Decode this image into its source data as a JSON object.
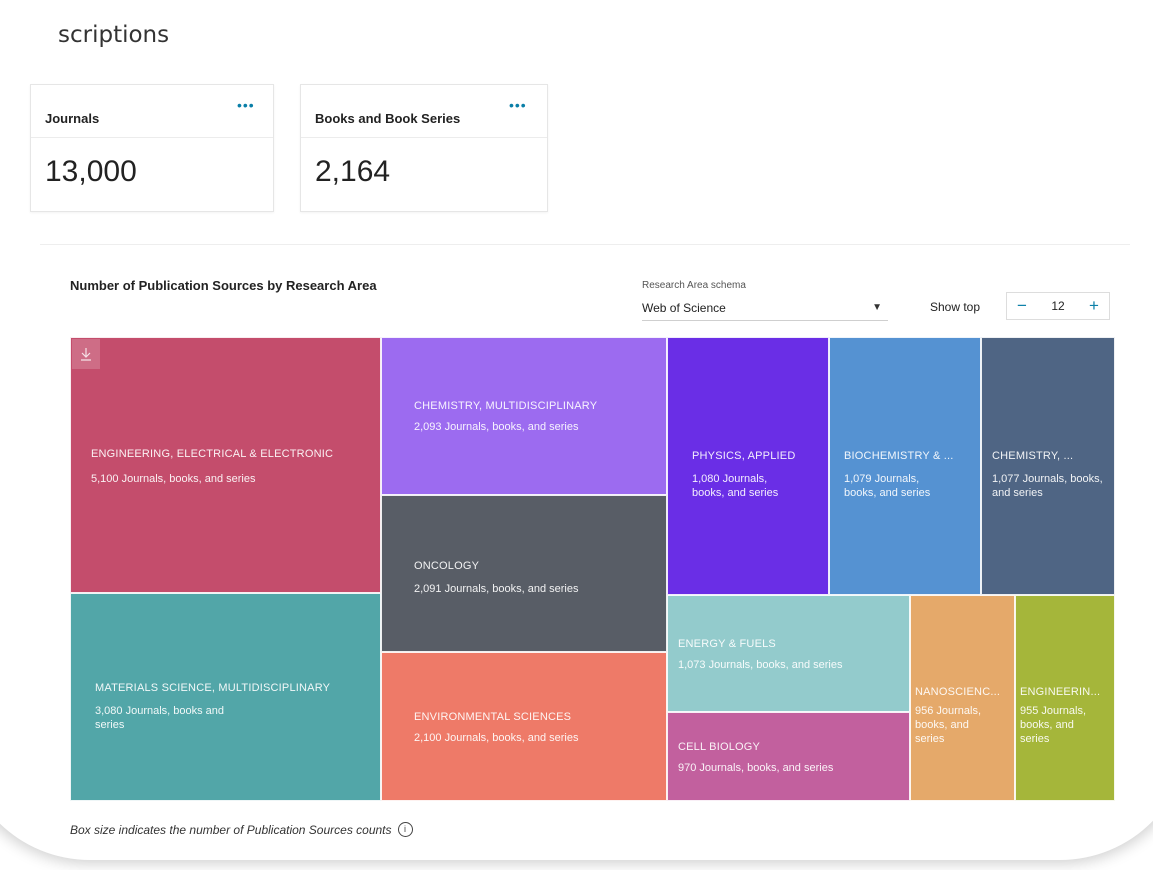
{
  "page": {
    "title": "scriptions"
  },
  "kpis": [
    {
      "label": "Journals",
      "value": "13,000",
      "more_icon": "more-dots-icon"
    },
    {
      "label": "Books and Book Series",
      "value": "2,164",
      "more_icon": "more-dots-icon"
    }
  ],
  "chart_panel": {
    "title": "Number of Publication Sources by Research Area",
    "schema_label": "Research Area schema",
    "schema_value": "Web of Science",
    "show_top_label": "Show top",
    "show_top_value": "12",
    "footnote": "Box size indicates the number of Publication Sources counts"
  },
  "chart_data": {
    "type": "heatmap",
    "title": "Number of Publication Sources by Research Area",
    "unit": "Journals, books, and series",
    "items": [
      {
        "name": "ENGINEERING, ELECTRICAL & ELECTRONIC",
        "value": 5100,
        "count_text": "5,100 Journals, books, and series",
        "color": "#c44d6c"
      },
      {
        "name": "MATERIALS SCIENCE, MULTIDISCIPLINARY",
        "value": 3080,
        "count_text": "3,080 Journals, books and series",
        "color": "#52a6a8"
      },
      {
        "name": "CHEMISTRY, MULTIDISCIPLINARY",
        "value": 2093,
        "count_text": "2,093 Journals, books, and series",
        "color": "#9c6bf0"
      },
      {
        "name": "ONCOLOGY",
        "value": 2091,
        "count_text": "2,091 Journals, books, and series",
        "color": "#585d66"
      },
      {
        "name": "ENVIRONMENTAL SCIENCES",
        "value": 2100,
        "count_text": "2,100 Journals, books, and series",
        "color": "#ee7a68"
      },
      {
        "name": "PHYSICS, APPLIED",
        "value": 1080,
        "count_text": "1,080 Journals, books, and series",
        "color": "#6a2ee6"
      },
      {
        "name": "BIOCHEMISTRY & ...",
        "value": 1079,
        "count_text": "1,079 Journals, books, and series",
        "color": "#5592d2"
      },
      {
        "name": "CHEMISTRY, ...",
        "value": 1077,
        "count_text": "1,077 Journals, books, and series",
        "color": "#4f6584"
      },
      {
        "name": "ENERGY & FUELS",
        "value": 1073,
        "count_text": "1,073 Journals, books, and series",
        "color": "#93cbcc"
      },
      {
        "name": "CELL BIOLOGY",
        "value": 970,
        "count_text": "970 Journals, books, and series",
        "color": "#c2609e"
      },
      {
        "name": "NANOSCIENC...",
        "value": 956,
        "count_text": "956 Journals, books, and series",
        "color": "#e5a96a"
      },
      {
        "name": "ENGINEERIN...",
        "value": 955,
        "count_text": "955 Journals, books, and series",
        "color": "#a5b63a"
      }
    ]
  }
}
